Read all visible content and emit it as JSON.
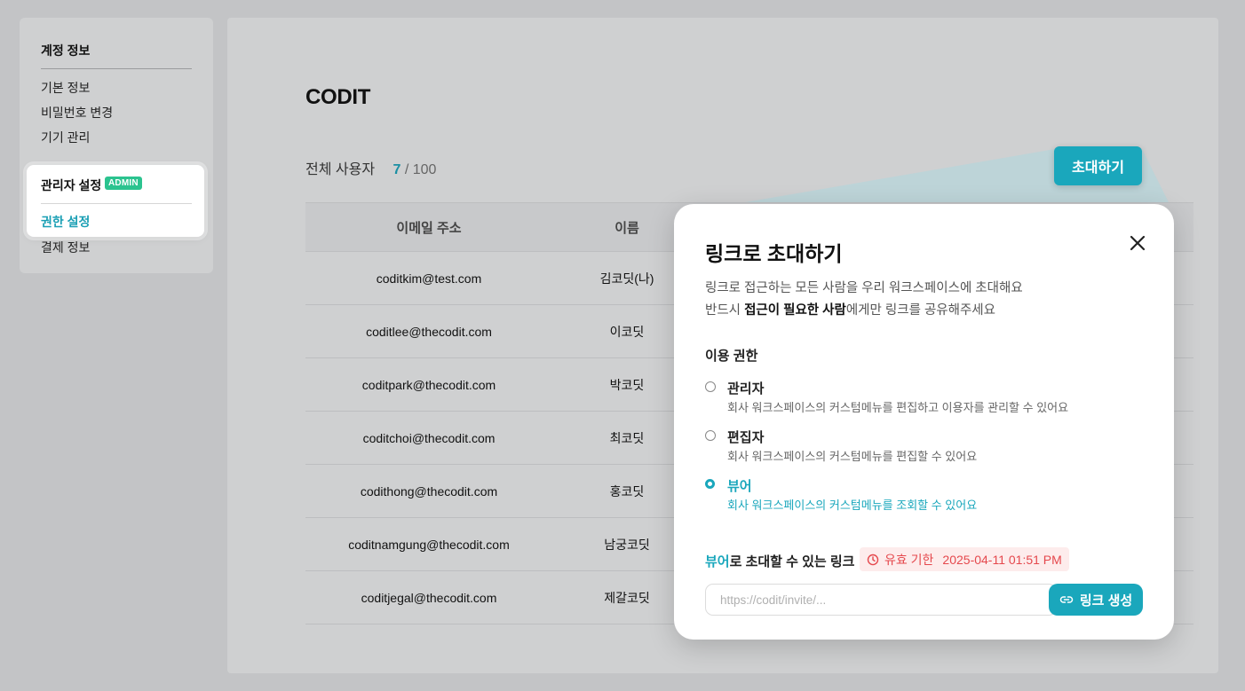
{
  "sidebar": {
    "account_title": "계정 정보",
    "account_items": [
      "기본 정보",
      "비밀번호 변경",
      "기기 관리"
    ],
    "admin_title": "관리자 설정",
    "admin_badge": "ADMIN",
    "admin_active_item": "권한 설정",
    "billing_item": "결제 정보"
  },
  "main": {
    "company": "CODIT",
    "total_users_label": "전체 사용자",
    "user_count": "7",
    "user_limit": "/ 100",
    "invite_button": "초대하기",
    "table": {
      "headers": [
        "이메일 주소",
        "이름"
      ],
      "rows": [
        [
          "coditkim@test.com",
          "김코딧(나)"
        ],
        [
          "coditlee@thecodit.com",
          "이코딧"
        ],
        [
          "coditpark@thecodit.com",
          "박코딧"
        ],
        [
          "coditchoi@thecodit.com",
          "최코딧"
        ],
        [
          "codithong@thecodit.com",
          "홍코딧"
        ],
        [
          "coditnamgung@thecodit.com",
          "남궁코딧"
        ],
        [
          "coditjegal@thecodit.com",
          "제갈코딧"
        ]
      ]
    }
  },
  "modal": {
    "title": "링크로 초대하기",
    "desc_line1": "링크로 접근하는 모든 사람을 우리 워크스페이스에 초대해요",
    "desc_line2_prefix": "반드시 ",
    "desc_line2_bold": "접근이 필요한 사람",
    "desc_line2_suffix": "에게만 링크를 공유해주세요",
    "permission_title": "이용 권한",
    "roles": [
      {
        "label": "관리자",
        "desc": "회사 워크스페이스의 커스텀메뉴를 편집하고 이용자를 관리할 수 있어요",
        "selected": false
      },
      {
        "label": "편집자",
        "desc": "회사 워크스페이스의 커스텀메뉴를 편집할 수 있어요",
        "selected": false
      },
      {
        "label": "뷰어",
        "desc": "회사 워크스페이스의 커스텀메뉴를 조회할 수 있어요",
        "selected": true
      }
    ],
    "link_title_role": "뷰어",
    "link_title_suffix": "로 초대할 수 있는 링크",
    "expiry_label": "유효 기한",
    "expiry_value": "2025-04-11 01:51 PM",
    "link_placeholder": "https://codit/invite/...",
    "link_value": "",
    "generate_button": "링크 생성"
  },
  "colors": {
    "accent": "#1aa7bc",
    "admin_badge": "#2bc38f",
    "expiry_text": "#e5484d",
    "expiry_bg": "#fdecec"
  },
  "icons": {
    "close": "close-icon",
    "clock": "clock-icon",
    "link": "link-icon"
  }
}
